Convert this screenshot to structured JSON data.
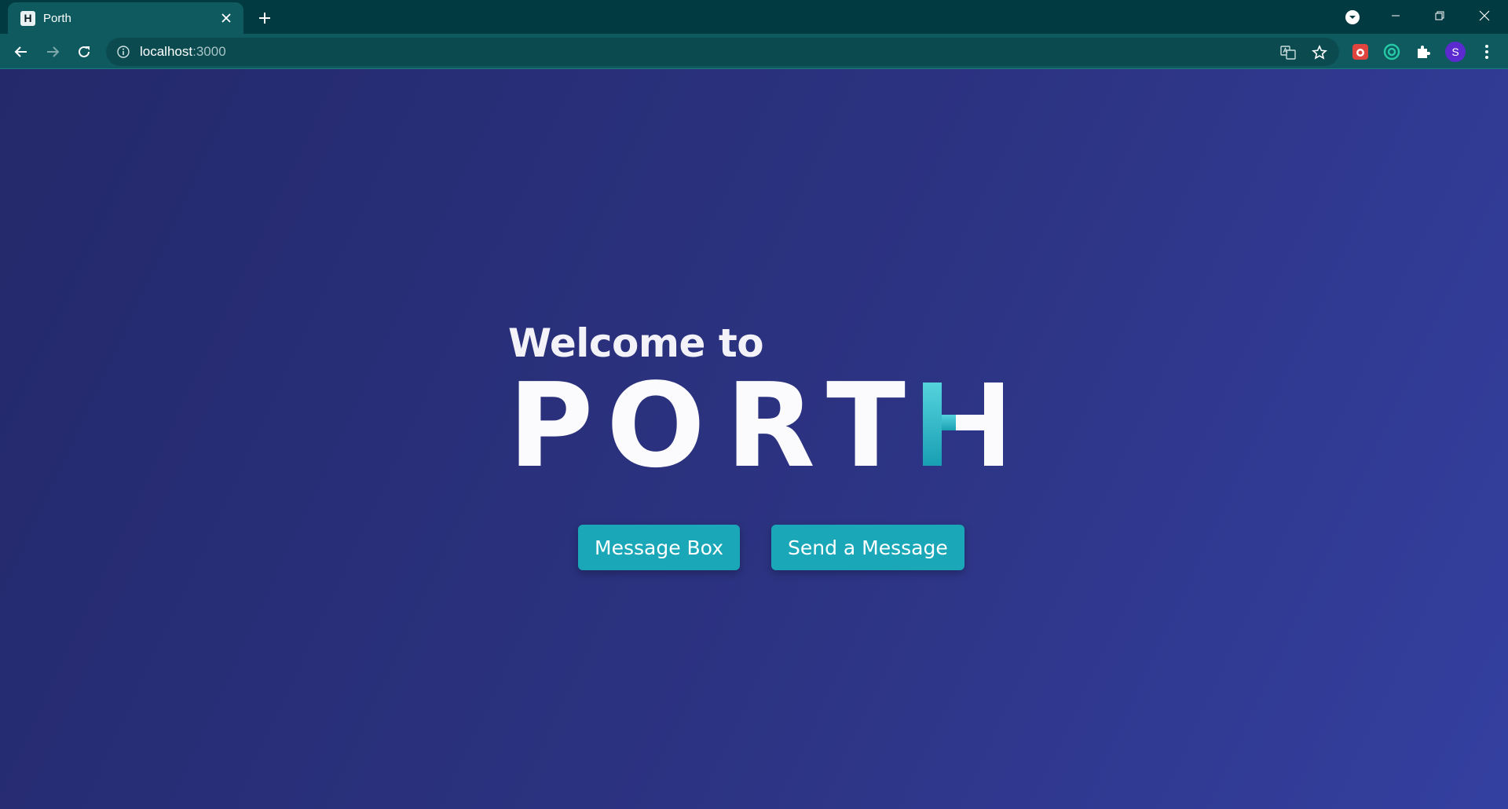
{
  "browser": {
    "tab": {
      "favicon_letter": "H",
      "title": "Porth"
    },
    "address": {
      "host": "localhost",
      "port": ":3000"
    },
    "profile_initial": "S"
  },
  "icons": {
    "tab_close": "close-icon",
    "new_tab": "plus-icon",
    "tab_search": "dropdown-circle-icon",
    "back": "arrow-left-icon",
    "forward": "arrow-right-icon",
    "reload": "reload-icon",
    "site_info": "info-icon",
    "translate": "translate-icon",
    "bookmark": "star-icon",
    "extensions": "puzzle-icon",
    "menu": "kebab-icon"
  },
  "page": {
    "welcome": "Welcome to",
    "brand": [
      "P",
      "O",
      "R",
      "T",
      "H"
    ],
    "buttons": {
      "message_box": "Message Box",
      "send_message": "Send a Message"
    }
  },
  "colors": {
    "accent": "#1aa7b8",
    "brand_accent": "#2ab7c8",
    "background_start": "#24296b",
    "background_end": "#3440a0",
    "chrome_dark": "#013a40",
    "chrome_toolbar": "#0e5a5f"
  }
}
